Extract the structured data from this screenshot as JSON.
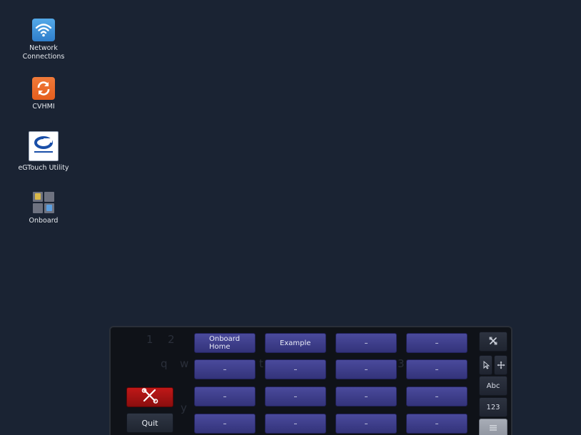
{
  "desktop": {
    "icons": [
      {
        "label_line1": "Network",
        "label_line2": "Connections",
        "icon": "network-wifi-icon"
      },
      {
        "label": "CVHMI",
        "icon": "sync-icon"
      },
      {
        "label": "eGTouch Utility",
        "icon": "egtouch-icon"
      },
      {
        "label": "Onboard",
        "icon": "onboard-icon"
      }
    ]
  },
  "keyboard": {
    "left": {
      "quit_label": "Quit",
      "tool_icon": "scissors-tools-icon"
    },
    "snippets": [
      [
        "Onboard\nHome",
        "Example",
        "–",
        "–"
      ],
      [
        "–",
        "–",
        "–",
        "–"
      ],
      [
        "–",
        "–",
        "–",
        "–"
      ],
      [
        "–",
        "–",
        "–",
        "–"
      ]
    ],
    "right": {
      "close_icon": "close-icon",
      "pointer_icon": "pointer-icon",
      "move_icon": "move-icon",
      "abc_label": "Abc",
      "num_label": "123",
      "menu_icon": "menu-icon"
    },
    "ghost_keys": [
      "1",
      "2",
      "q",
      "w",
      "t",
      "y",
      "3"
    ]
  },
  "colors": {
    "desktop_bg": "#1a2333",
    "keyboard_bg": "#0f1218",
    "snippet_key": "#3d3d8a",
    "tool_key": "#b51414"
  }
}
